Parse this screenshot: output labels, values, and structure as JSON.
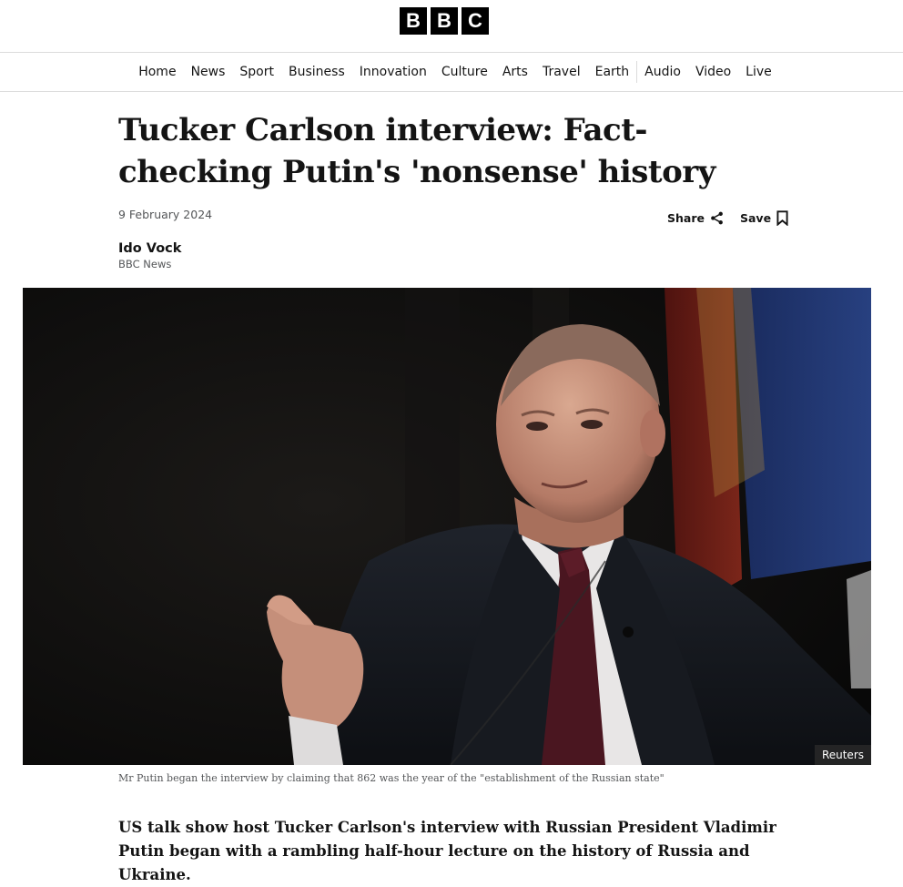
{
  "brand": {
    "letters": [
      "B",
      "B",
      "C"
    ]
  },
  "nav": {
    "items": [
      "Home",
      "News",
      "Sport",
      "Business",
      "Innovation",
      "Culture",
      "Arts",
      "Travel",
      "Earth",
      "Audio",
      "Video",
      "Live"
    ]
  },
  "article": {
    "headline": "Tucker Carlson interview: Fact-checking Putin's 'nonsense' history",
    "date": "9 February 2024",
    "share_label": "Share",
    "save_label": "Save",
    "author_name": "Ido Vock",
    "author_org": "BBC News",
    "image_credit": "Reuters",
    "caption": "Mr Putin began the interview by claiming that 862 was the year of the \"establishment of the Russian state\"",
    "lede": "US talk show host Tucker Carlson's interview with Russian President Vladimir Putin began with a rambling half-hour lecture on the history of Russia and Ukraine."
  },
  "icons": {
    "share": "share-icon",
    "save": "bookmark-icon"
  }
}
